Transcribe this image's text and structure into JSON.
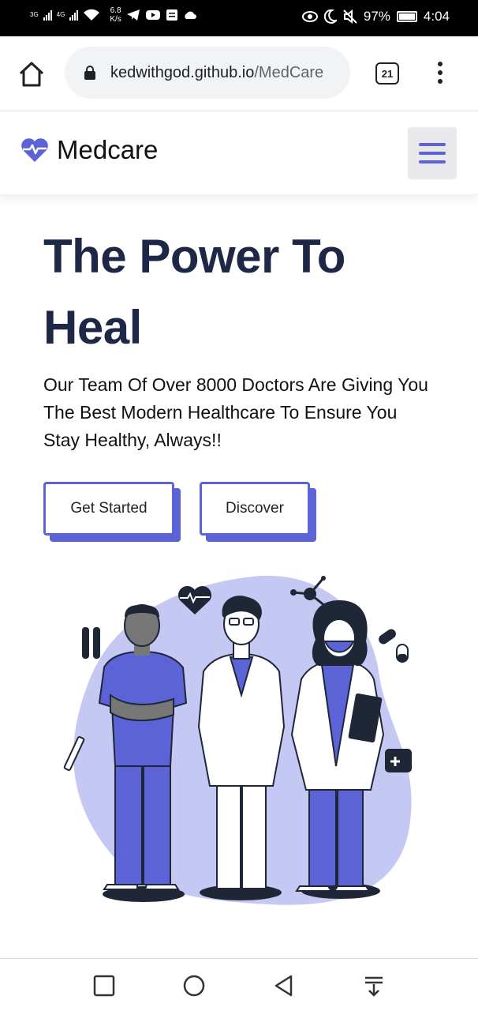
{
  "status_bar": {
    "network_1": "3G",
    "network_2": "4G",
    "speed_value": "6.8",
    "speed_unit": "K/s",
    "battery": "97%",
    "time": "4:04"
  },
  "browser": {
    "url_domain": "kedwithgod.github.io",
    "url_path": "/MedCare",
    "tab_count": "21"
  },
  "site": {
    "brand": "Medcare",
    "accent_color": "#5b63d6",
    "title_color": "#1f2747"
  },
  "hero": {
    "title": "The Power To Heal",
    "subtitle": "Our Team Of Over 8000 Doctors Are Giving You The Best Modern Healthcare To Ensure You Stay Healthy, Always!!",
    "primary_button": "Get Started",
    "secondary_button": "Discover"
  },
  "icons": [
    "heart-pulse-icon",
    "hamburger-menu-icon",
    "home-icon",
    "lock-icon",
    "more-vert-icon",
    "recent-apps-icon",
    "home-circle-icon",
    "back-icon",
    "notification-shade-icon"
  ]
}
